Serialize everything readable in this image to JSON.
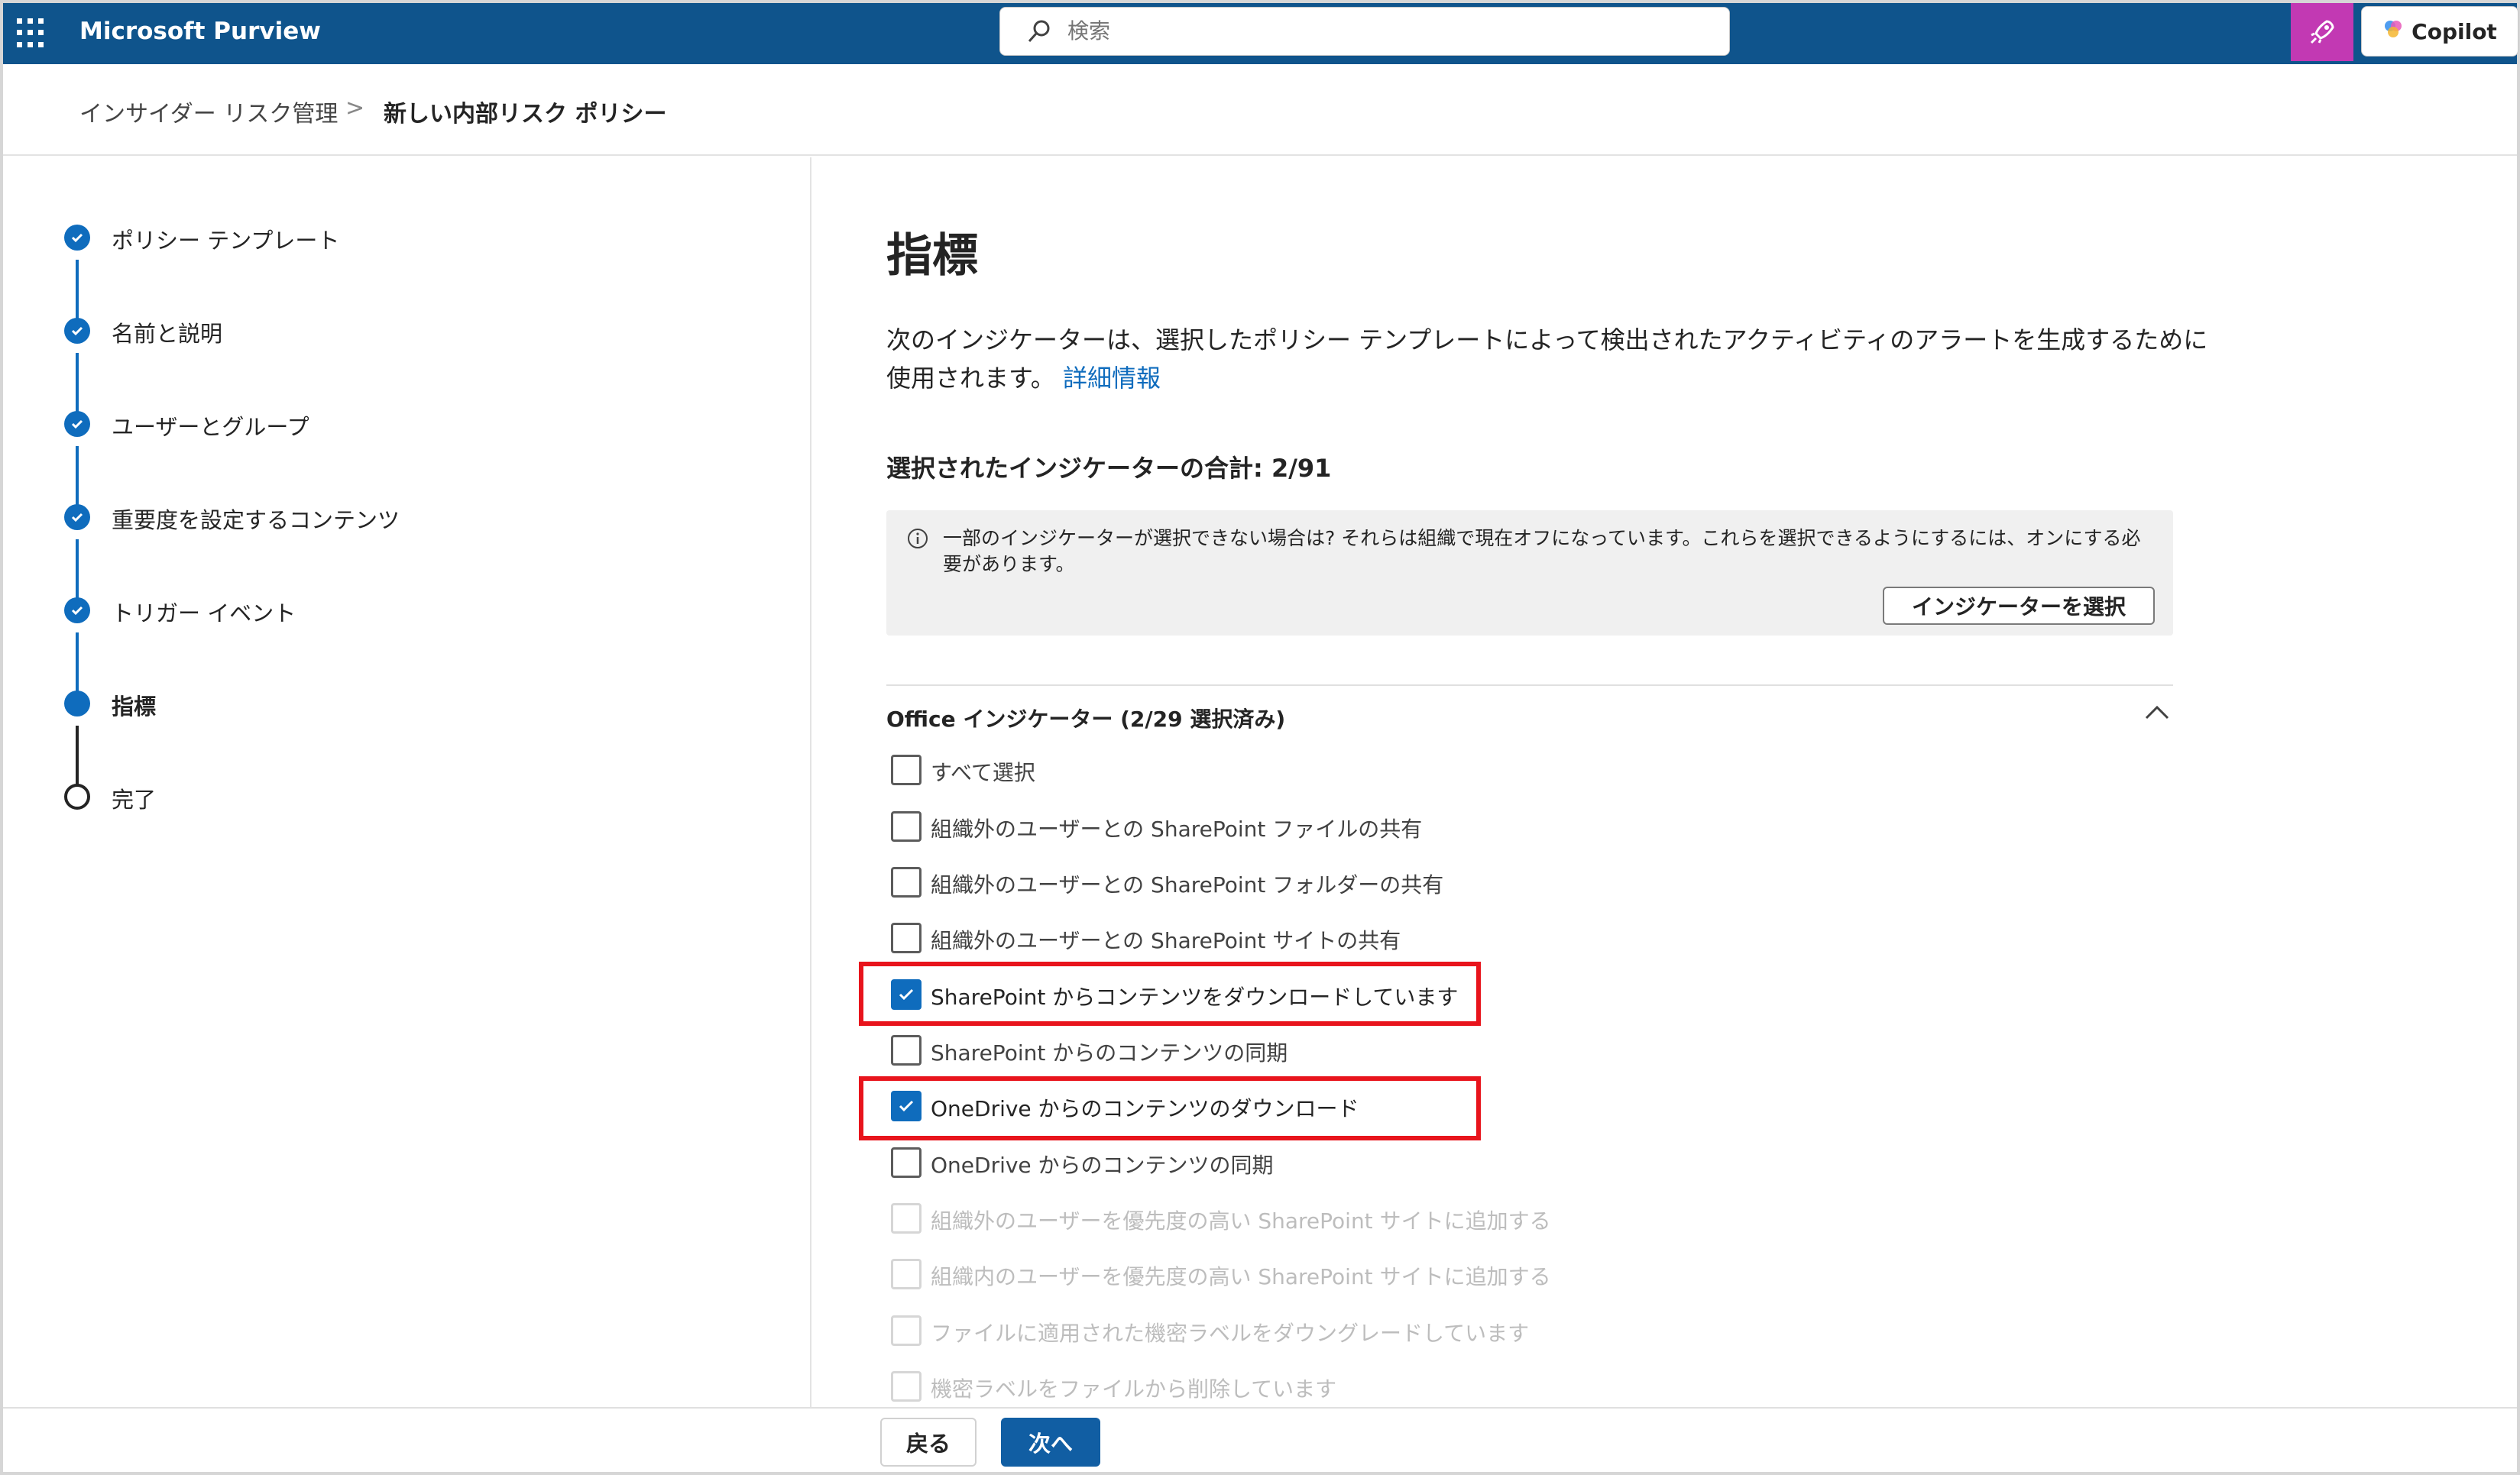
{
  "app": {
    "title": "Microsoft Purview"
  },
  "search": {
    "placeholder": "検索"
  },
  "copilot": {
    "label": "Copilot"
  },
  "breadcrumb": {
    "parent": "インサイダー リスク管理",
    "separator": ">",
    "current": "新しい内部リスク ポリシー"
  },
  "steps": [
    {
      "label": "ポリシー テンプレート",
      "state": "completed"
    },
    {
      "label": "名前と説明",
      "state": "completed"
    },
    {
      "label": "ユーザーとグループ",
      "state": "completed"
    },
    {
      "label": "重要度を設定するコンテンツ",
      "state": "completed"
    },
    {
      "label": "トリガー イベント",
      "state": "completed"
    },
    {
      "label": "指標",
      "state": "current"
    },
    {
      "label": "完了",
      "state": "pending"
    }
  ],
  "main": {
    "title": "指標",
    "description": "次のインジケーターは、選択したポリシー テンプレートによって検出されたアクティビティのアラートを生成するために使用されます。",
    "learn_more": "詳細情報",
    "total_label": "選択されたインジケーターの合計: 2/91",
    "info_text": "一部のインジケーターが選択できない場合は? それらは組織で現在オフになっています。これらを選択できるようにするには、オンにする必要があります。",
    "info_button": "インジケーターを選択",
    "section_title": "Office インジケーター (2/29 選択済み)",
    "checkboxes": [
      {
        "label": "すべて選択",
        "checked": false,
        "disabled": false
      },
      {
        "label": "組織外のユーザーとの SharePoint ファイルの共有",
        "checked": false,
        "disabled": false
      },
      {
        "label": "組織外のユーザーとの SharePoint フォルダーの共有",
        "checked": false,
        "disabled": false
      },
      {
        "label": "組織外のユーザーとの SharePoint サイトの共有",
        "checked": false,
        "disabled": false
      },
      {
        "label": "SharePoint からコンテンツをダウンロードしています",
        "checked": true,
        "disabled": false
      },
      {
        "label": "SharePoint からのコンテンツの同期",
        "checked": false,
        "disabled": false
      },
      {
        "label": "OneDrive からのコンテンツのダウンロード",
        "checked": true,
        "disabled": false
      },
      {
        "label": "OneDrive からのコンテンツの同期",
        "checked": false,
        "disabled": false
      },
      {
        "label": "組織外のユーザーを優先度の高い SharePoint サイトに追加する",
        "checked": false,
        "disabled": true
      },
      {
        "label": "組織内のユーザーを優先度の高い SharePoint サイトに追加する",
        "checked": false,
        "disabled": true
      },
      {
        "label": "ファイルに適用された機密ラベルをダウングレードしています",
        "checked": false,
        "disabled": true
      },
      {
        "label": "機密ラベルをファイルから削除しています",
        "checked": false,
        "disabled": true
      }
    ]
  },
  "footer": {
    "back_label": "戻る",
    "next_label": "次へ"
  },
  "colors": {
    "header": "#0f548c",
    "accent": "#0f6cbd",
    "highlight": "#e8141c",
    "copilot_tile": "#c239b3"
  }
}
